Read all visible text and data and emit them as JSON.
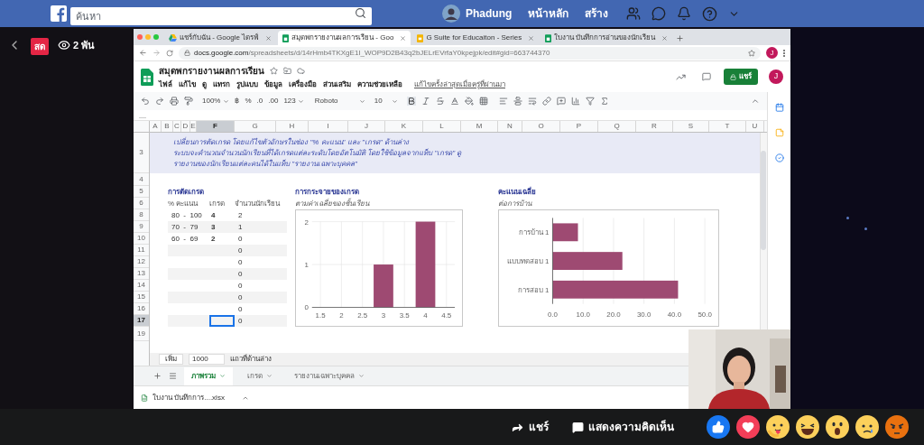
{
  "facebook_bar": {
    "search_placeholder": "ค้นหา",
    "user": "Phadung",
    "nav": [
      "หน้าหลัก",
      "สร้าง"
    ]
  },
  "live": {
    "badge": "สด",
    "viewers": "2 พัน"
  },
  "browser": {
    "tabs": [
      {
        "title": "แชร์กับฉัน - Google ไดรฟ์",
        "kind": "drive",
        "selected": false
      },
      {
        "title": "สมุดพกรายงานผลการเรียน - Goo",
        "kind": "sheets",
        "selected": true
      },
      {
        "title": "G Suite for Educaiton - Series",
        "kind": "slides",
        "selected": false
      },
      {
        "title": "ใบงาน บันทึกการอ่านของนักเรียน",
        "kind": "sheets",
        "selected": false
      }
    ],
    "url_host": "docs.google.com",
    "url_path": "/spreadsheets/d/14rHmb4TKXgE1I_WOP9D2B43q2bJELrEVrfaY0kpejpk/edit#gid=663744370",
    "profile": "J"
  },
  "sheet": {
    "title": "สมุดพกรายงานผลการเรียน",
    "menu": [
      "ไฟล์",
      "แก้ไข",
      "ดู",
      "แทรก",
      "รูปแบบ",
      "ข้อมูล",
      "เครื่องมือ",
      "ส่วนเสริม",
      "ความช่วยเหลือ"
    ],
    "last_edit": "แก้ไขครั้งล่าสุดเมื่อครู่ที่ผ่านมา",
    "share": "แชร์",
    "avatar": "J",
    "toolbar": {
      "zoom": "100%",
      "currency": "฿",
      "percent": "%",
      "decrease_decimal": ".0",
      "increase_decimal": ".00",
      "more_formats": "123",
      "font": "Roboto",
      "font_size": "10"
    },
    "columns": [
      {
        "label": "A",
        "selected": false
      },
      {
        "label": "B",
        "selected": false
      },
      {
        "label": "C",
        "selected": false
      },
      {
        "label": "D",
        "selected": false
      },
      {
        "label": "E",
        "selected": false
      },
      {
        "label": "F",
        "selected": true
      },
      {
        "label": "G",
        "selected": false
      },
      {
        "label": "H",
        "selected": false
      },
      {
        "label": "I",
        "selected": false
      },
      {
        "label": "J",
        "selected": false
      },
      {
        "label": "K",
        "selected": false
      },
      {
        "label": "L",
        "selected": false
      },
      {
        "label": "M",
        "selected": false
      },
      {
        "label": "N",
        "selected": false
      },
      {
        "label": "O",
        "selected": false
      },
      {
        "label": "P",
        "selected": false
      },
      {
        "label": "Q",
        "selected": false
      },
      {
        "label": "R",
        "selected": false
      },
      {
        "label": "S",
        "selected": false
      },
      {
        "label": "T",
        "selected": false
      },
      {
        "label": "U",
        "selected": false
      }
    ],
    "rows": [
      {
        "label": "3",
        "selected": false
      },
      {
        "label": "4",
        "selected": false
      },
      {
        "label": "5",
        "selected": false
      },
      {
        "label": "6",
        "selected": false
      },
      {
        "label": "8",
        "selected": false
      },
      {
        "label": "9",
        "selected": false
      },
      {
        "label": "10",
        "selected": false
      },
      {
        "label": "11",
        "selected": false
      },
      {
        "label": "12",
        "selected": false
      },
      {
        "label": "13",
        "selected": false
      },
      {
        "label": "14",
        "selected": false
      },
      {
        "label": "15",
        "selected": false
      },
      {
        "label": "16",
        "selected": false
      },
      {
        "label": "17",
        "selected": true
      },
      {
        "label": "19",
        "selected": false
      }
    ],
    "notes": [
      "เปลี่ยนการตัดเกรด โดยแก้ไขตัวอักษรในช่อง \"% คะแนน\" และ \"เกรด\" ด้านล่าง",
      "ระบบจะคำนวณจำนวนนักเรียนที่ได้เกรดแต่ละระดับโดยอัตโนมัติ โดยใช้ข้อมูลจากแท็บ \"เกรด\" ดู",
      "รายงานของนักเรียนแต่ละคนได้ในแท็บ \"รายงานเฉพาะบุคคล\""
    ],
    "grade_table": {
      "title": "การตัดเกรด",
      "headers": [
        "% คะแนน",
        "เกรด",
        "จำนวนนักเรียน"
      ],
      "rows": [
        {
          "score_range": "80  -  100",
          "grade": "4",
          "count": "2",
          "selected": false
        },
        {
          "score_range": "70  -  79",
          "grade": "3",
          "count": "1",
          "selected": false
        },
        {
          "score_range": "60  -  69",
          "grade": "2",
          "count": "0",
          "selected": false
        },
        {
          "count": "0",
          "selected": false
        },
        {
          "count": "0",
          "selected": false
        },
        {
          "count": "0",
          "selected": false
        },
        {
          "count": "0",
          "selected": false
        },
        {
          "count": "0",
          "selected": false
        },
        {
          "count": "0",
          "selected": false
        },
        {
          "count": "0",
          "selected": true
        }
      ]
    },
    "charts": [
      {
        "title": "การกระจายของเกรด",
        "subtitle": "ตามค่าเฉลี่ยของชั้นเรียน",
        "chart_data": {
          "type": "bar",
          "x": [
            3,
            4
          ],
          "grid": true,
          "series": [
            {
              "color": "#9e4a72",
              "values": [
                1,
                2
              ]
            }
          ],
          "xlim": [
            1.3,
            4.7
          ],
          "ylim": [
            0,
            2
          ],
          "xticks": [
            1.5,
            2,
            2.5,
            3,
            3.5,
            4,
            4.5
          ],
          "yticks": [
            0,
            1,
            2
          ]
        }
      },
      {
        "title": "คะแนนเฉลี่ย",
        "subtitle": "ต่อการบ้าน",
        "chart_data": {
          "type": "bar",
          "orientation": "horizontal",
          "categories": [
            "การบ้าน 1",
            "แบบทดสอบ 1",
            "การสอบ 1"
          ],
          "grid": true,
          "series": [
            {
              "color": "#9e4a72",
              "values": [
                8.3,
                22.9,
                41.2
              ]
            }
          ],
          "xlim": [
            0,
            50
          ],
          "xticks": [
            {
              "value": 0,
              "label": "0.0"
            },
            {
              "value": 10,
              "label": "10.0"
            },
            {
              "value": 20,
              "label": "20.0"
            },
            {
              "value": 30,
              "label": "30.0"
            },
            {
              "value": 40,
              "label": "40.0"
            },
            {
              "value": 50,
              "label": "50.0"
            }
          ]
        }
      }
    ],
    "add_rows": {
      "button": "เพิ่ม",
      "value": "1000",
      "label": "แถวที่ด้านล่าง"
    },
    "sheet_tabs": [
      {
        "label": "ภาพรวม",
        "selected": true
      },
      {
        "label": "เกรด",
        "selected": false
      },
      {
        "label": "รายงานเฉพาะบุคคล",
        "selected": false
      }
    ]
  },
  "download": {
    "file": "ใบงาน บันทึกการ....xlsx"
  },
  "actions": {
    "share": "แชร์",
    "comment": "แสดงความคิดเห็น"
  }
}
